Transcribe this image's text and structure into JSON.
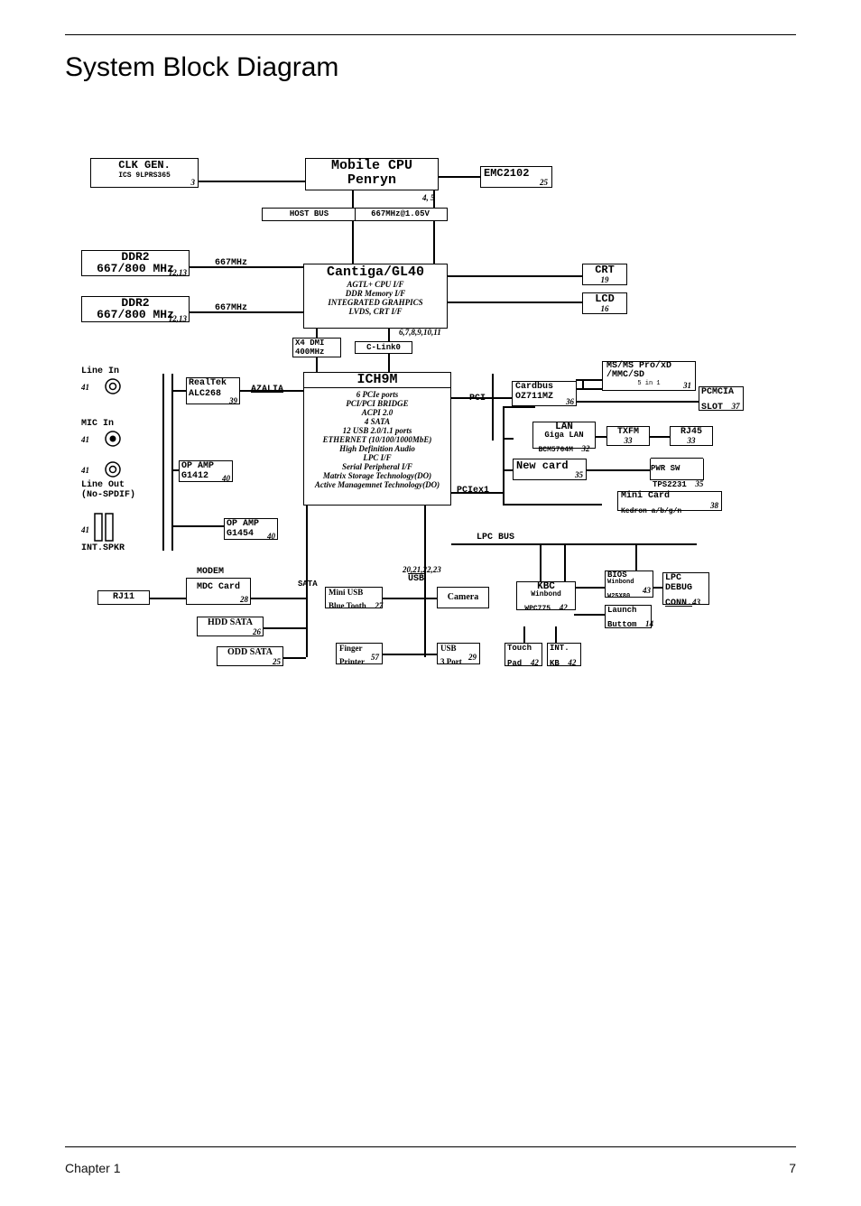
{
  "title": "System Block Diagram",
  "footer": {
    "chapter": "Chapter 1",
    "page": "7"
  },
  "clk_gen": {
    "l1": "CLK GEN.",
    "l2": "ICS 9LPRS365",
    "ref": "3"
  },
  "cpu": {
    "l1": "Mobile CPU",
    "l2": "Penryn",
    "ref": "4, 5"
  },
  "emc": {
    "l1": "EMC2102",
    "ref": "25"
  },
  "host_bus": {
    "l1": "HOST BUS",
    "l2": "667MHz@1.05V"
  },
  "ddr2_top": {
    "l1": "DDR2",
    "l2": "667/800 MHz",
    "ref": "12,13"
  },
  "ddr2_bot": {
    "l1": "DDR2",
    "l2": "667/800 MHz",
    "ref": "12,13"
  },
  "bus_667_top": "667MHz",
  "bus_667_bot": "667MHz",
  "gmch": {
    "title": "Cantiga/GL40",
    "items": [
      "AGTL+ CPU I/F",
      "DDR Memory I/F",
      "INTEGRATED GRAHPICS",
      "LVDS, CRT I/F"
    ],
    "ref": "6,7,8,9,10,11"
  },
  "dmi": {
    "l1": "X4 DMI",
    "l2": "400MHz"
  },
  "clink": "C-Link0",
  "crt": {
    "l1": "CRT",
    "ref": "19"
  },
  "lcd": {
    "l1": "LCD",
    "ref": "16"
  },
  "ich": {
    "title": "ICH9M",
    "items": [
      "6 PCIe ports",
      "PCI/PCI BRIDGE",
      "ACPI 2.0",
      "4 SATA",
      "12 USB 2.0/1.1 ports",
      "ETHERNET (10/100/1000MbE)",
      "High Definition Audio",
      "LPC I/F",
      "Serial Peripheral I/F",
      "Matrix Storage Technology(DO)",
      "Active Managemnet Technology(DO)"
    ]
  },
  "azalia": "AZALIA",
  "pci": "PCI",
  "pciex1": "PCIex1",
  "realtek": {
    "l1": "RealTek",
    "l2": "ALC268",
    "ref": "39"
  },
  "opamp1": {
    "l1": "OP AMP",
    "l2": "G1412",
    "ref": "40"
  },
  "opamp2": {
    "l1": "OP AMP",
    "l2": "G1454",
    "ref": "40"
  },
  "line_in": "Line In",
  "mic_in": "MIC In",
  "line_out": "Line Out",
  "no_spdif": "(No-SPDIF)",
  "int_spkr": "INT.SPKR",
  "a41": "41",
  "cardreader": {
    "l1": "MS/MS Pro/xD",
    "l2": "/MMC/SD",
    "sub": "5 in 1",
    "ref": "31"
  },
  "pcmcia": {
    "l1": "PCMCIA",
    "l2": "SLOT",
    "ref": "37"
  },
  "cardbus": {
    "l1": "Cardbus",
    "l2": "OZ711MZ",
    "ref": "36"
  },
  "lan": {
    "l1": "LAN",
    "l2": "Giga LAN",
    "l3": "BCM5764M",
    "ref": "32"
  },
  "txfm": {
    "l1": "TXFM",
    "ref": "33"
  },
  "rj45": {
    "l1": "RJ45",
    "ref": "33"
  },
  "newcard": {
    "l1": "New card",
    "ref": "35"
  },
  "pwr_sw": {
    "l1": "PWR SW",
    "l2": "TPS2231",
    "ref": "35"
  },
  "minicard": {
    "l1": "Mini Card",
    "l2": "Kedron a/b/g/n",
    "ref": "38"
  },
  "lpc_bus": "LPC BUS",
  "modem_top": "MODEM",
  "rj11": "RJ11",
  "modem": {
    "l1": "MDC Card",
    "ref": "28"
  },
  "hdd": {
    "l1": "HDD SATA",
    "ref": "26"
  },
  "odd": {
    "l1": "ODD SATA",
    "ref": "25"
  },
  "sata": "SATA",
  "usb_bus_ref": "20,21,22,23",
  "usb_label": "USB",
  "mini_usb": {
    "l1": "Mini USB",
    "l2": "Blue Tooth",
    "ref": "27"
  },
  "camera": {
    "l1": "Camera"
  },
  "finger": {
    "l1": "Finger",
    "l2": "Printer",
    "ref": "57"
  },
  "usb3": {
    "l1": "USB",
    "l2": "3 Port",
    "ref": "29"
  },
  "kbc": {
    "l1": "KBC",
    "l2": "Winbond",
    "l3": "WPC775",
    "ref": "42"
  },
  "bios": {
    "l1": "BIOS",
    "l2": "Winbond",
    "l3": "W25X80",
    "ref": "43"
  },
  "launch": {
    "l1": "Launch",
    "l2": "Buttom",
    "ref": "14"
  },
  "touch": {
    "l1": "Touch",
    "l2": "Pad",
    "ref": "42"
  },
  "intkb": {
    "l1": "INT.",
    "l2": "KB",
    "ref": "42"
  },
  "lpc_debug": {
    "l1": "LPC",
    "l2": "DEBUG",
    "l3": "CONN.",
    "ref": "43"
  }
}
